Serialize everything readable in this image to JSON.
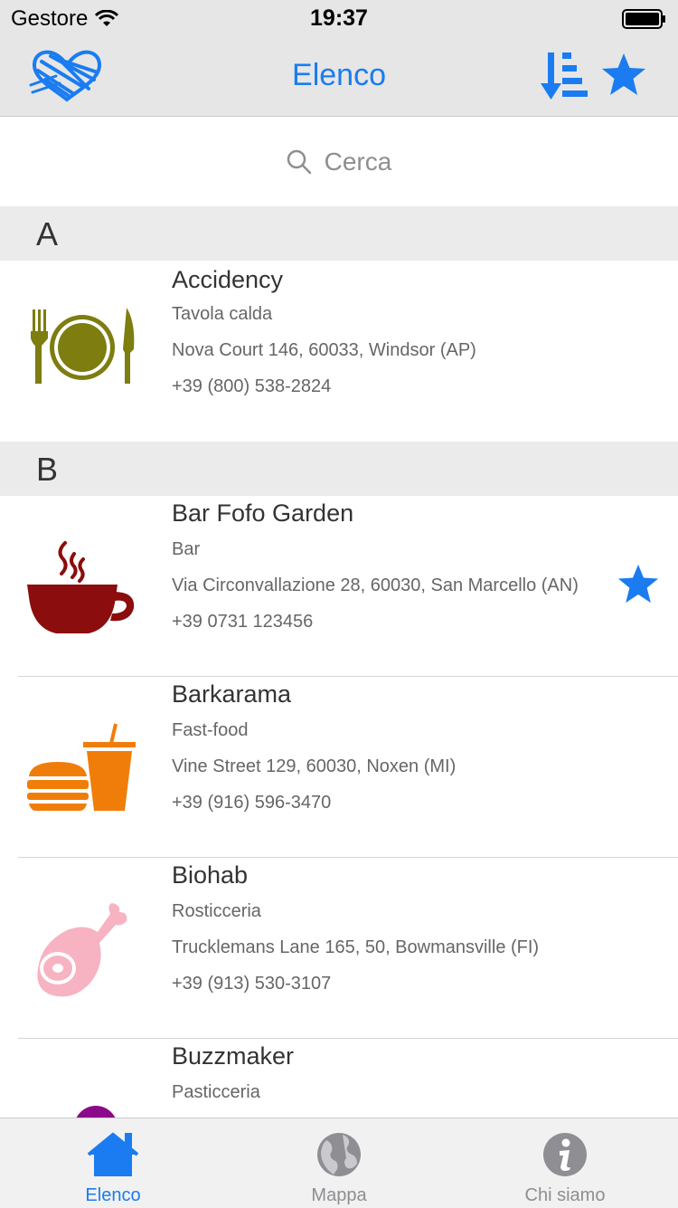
{
  "status_bar": {
    "carrier": "Gestore",
    "time": "19:37"
  },
  "nav": {
    "title": "Elenco",
    "logo_icon": "heart-logo-icon",
    "sort_icon": "sort-descending-icon",
    "favorites_icon": "star-icon"
  },
  "search": {
    "placeholder": "Cerca"
  },
  "colors": {
    "accent": "#1a7cf0",
    "section_bg": "#ebebeb",
    "bar_bg": "#e6e6e6"
  },
  "sections": [
    {
      "letter": "A",
      "items": [
        {
          "name": "Accidency",
          "category": "Tavola calda",
          "address": "Nova Court 146, 60033, Windsor (AP)",
          "phone": "+39 (800) 538-2824",
          "icon": "plate-cutlery-icon",
          "favorite": false
        }
      ]
    },
    {
      "letter": "B",
      "items": [
        {
          "name": "Bar Fofo Garden",
          "category": "Bar",
          "address": "Via Circonvallazione 28, 60030, San Marcello (AN)",
          "phone": "+39 0731 123456",
          "icon": "coffee-cup-icon",
          "favorite": true
        },
        {
          "name": "Barkarama",
          "category": "Fast-food",
          "address": "Vine Street 129, 60030, Noxen (MI)",
          "phone": "+39 (916) 596-3470",
          "icon": "burger-drink-icon",
          "favorite": false
        },
        {
          "name": "Biohab",
          "category": "Rosticceria",
          "address": "Trucklemans Lane 165, 50, Bowmansville (FI)",
          "phone": "+39 (913) 530-3107",
          "icon": "ham-icon",
          "favorite": false
        },
        {
          "name": "Buzzmaker",
          "category": "Pasticceria",
          "address": "",
          "phone": "",
          "icon": "pastry-chef-icon",
          "favorite": false
        }
      ]
    }
  ],
  "tabs": [
    {
      "label": "Elenco",
      "icon": "home-icon",
      "active": true
    },
    {
      "label": "Mappa",
      "icon": "globe-icon",
      "active": false
    },
    {
      "label": "Chi siamo",
      "icon": "info-icon",
      "active": false
    }
  ]
}
